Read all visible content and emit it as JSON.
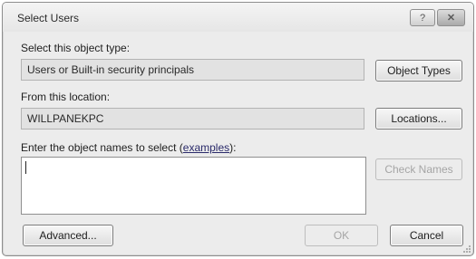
{
  "window": {
    "title": "Select Users",
    "help_glyph": "?",
    "close_glyph": "✕"
  },
  "object_type": {
    "label": "Select this object type:",
    "value": "Users or Built-in security principals",
    "button": "Object Types"
  },
  "location": {
    "label": "From this location:",
    "value": "WILLPANEKPC",
    "button": "Locations..."
  },
  "names": {
    "label_before": "Enter the object names to select (",
    "label_link": "examples",
    "label_after": "):",
    "value": "",
    "check_button": "Check Names"
  },
  "footer": {
    "advanced_button": "Advanced...",
    "ok_button": "OK",
    "cancel_button": "Cancel"
  }
}
